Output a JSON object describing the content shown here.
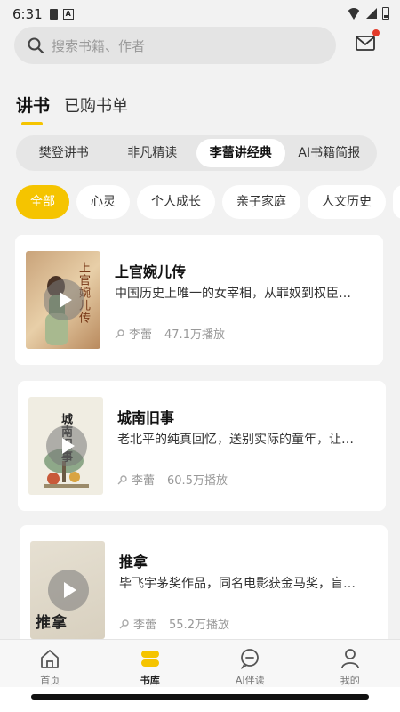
{
  "status_bar": {
    "time": "6:31",
    "icons": [
      "sim-card-icon",
      "a-notification-icon",
      "wifi-icon",
      "signal-icon",
      "battery-icon"
    ]
  },
  "search": {
    "placeholder": "搜索书籍、作者",
    "icon": "search-icon"
  },
  "mail": {
    "icon": "mail-icon",
    "has_badge": true,
    "badge_color": "#e23a2a"
  },
  "main_tabs": [
    {
      "label": "讲书",
      "active": true
    },
    {
      "label": "已购书单",
      "active": false
    }
  ],
  "segments": [
    {
      "label": "樊登讲书",
      "active": false
    },
    {
      "label": "非凡精读",
      "active": false
    },
    {
      "label": "李蕾讲经典",
      "active": true
    },
    {
      "label": "AI书籍简报",
      "active": false
    }
  ],
  "chips": [
    {
      "label": "全部",
      "active": true
    },
    {
      "label": "心灵",
      "active": false
    },
    {
      "label": "个人成长",
      "active": false
    },
    {
      "label": "亲子家庭",
      "active": false
    },
    {
      "label": "人文历史",
      "active": false
    }
  ],
  "books": [
    {
      "title": "上官婉儿传",
      "cover_text": "上官婉儿传",
      "description": "中国历史上唯一的女宰相，从罪奴到权臣…",
      "author": "李蕾",
      "plays": "47.1万播放"
    },
    {
      "title": "城南旧事",
      "cover_text": "城南旧事",
      "description": "老北平的纯真回忆，送别实际的童年，让…",
      "author": "李蕾",
      "plays": "60.5万播放"
    },
    {
      "title": "推拿",
      "cover_text": "推拿",
      "description": "毕飞宇茅奖作品，同名电影获金马奖，盲…",
      "author": "李蕾",
      "plays": "55.2万播放"
    }
  ],
  "bottom_nav": [
    {
      "label": "首页",
      "icon": "home-icon",
      "active": false
    },
    {
      "label": "书库",
      "icon": "library-icon",
      "active": true
    },
    {
      "label": "AI伴读",
      "icon": "ai-chat-icon",
      "active": false
    },
    {
      "label": "我的",
      "icon": "profile-icon",
      "active": false
    }
  ],
  "colors": {
    "accent": "#f5c400",
    "background": "#f2f2f2",
    "card": "#ffffff"
  }
}
